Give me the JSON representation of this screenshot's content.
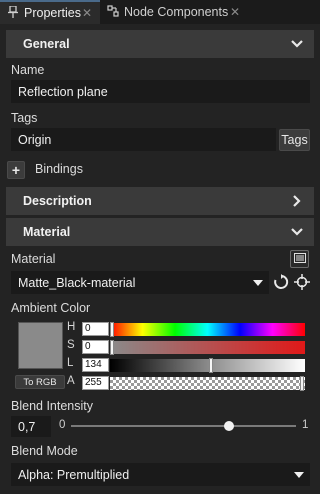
{
  "tabs": {
    "properties": "Properties",
    "node_components": "Node Components"
  },
  "general": {
    "title": "General",
    "name_label": "Name",
    "name_value": "Reflection plane",
    "tags_label": "Tags",
    "tags_value": "Origin",
    "tags_button": "Tags",
    "bindings_label": "Bindings",
    "add_symbol": "+"
  },
  "description": {
    "title": "Description"
  },
  "material": {
    "title": "Material",
    "material_label": "Material",
    "material_value": "Matte_Black-material",
    "ambient_label": "Ambient Color",
    "ambient_swatch_color": "#8a8a8a",
    "h_label": "H",
    "h_value": "0",
    "s_label": "S",
    "s_value": "0",
    "l_label": "L",
    "l_value": "134",
    "a_label": "A",
    "a_value": "255",
    "to_rgb": "To RGB",
    "blend_intensity_label": "Blend Intensity",
    "blend_intensity_value": "0,7",
    "slider_min": "0",
    "slider_max": "1",
    "slider_fraction": 0.7,
    "blend_mode_label": "Blend Mode",
    "blend_mode_value": "Alpha: Premultiplied"
  },
  "colors": {
    "panel_bg": "#232323",
    "section_bg": "#3a3a3a",
    "field_bg": "#1a1a1a",
    "accent_tab": "#4a6a8a"
  },
  "icons": {
    "tab_properties": "pin-icon",
    "tab_nodes": "node-components-icon"
  }
}
